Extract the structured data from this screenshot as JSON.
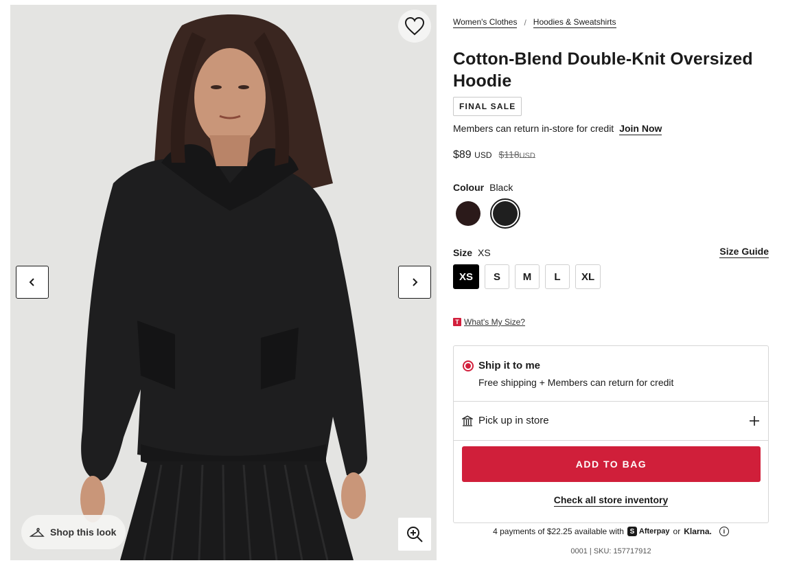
{
  "breadcrumb": [
    {
      "label": "Women's Clothes"
    },
    {
      "label": "Hoodies & Sweatshirts"
    }
  ],
  "breadcrumb_separator": "/",
  "product": {
    "title": "Cotton-Blend Double-Knit Oversized Hoodie",
    "badge": "FINAL SALE",
    "members_text": "Members can return in-store for credit",
    "join_link": "Join Now",
    "price_now": "$89",
    "price_now_currency": "USD",
    "price_was": "$118",
    "price_was_currency": "USD"
  },
  "colour": {
    "label": "Colour",
    "selected": "Black",
    "swatches": [
      {
        "name": "Espresso",
        "hex": "#2b1a1a",
        "selected": false
      },
      {
        "name": "Black",
        "hex": "#1f1f1f",
        "selected": true
      }
    ]
  },
  "size": {
    "label": "Size",
    "selected": "XS",
    "guide_label": "Size Guide",
    "options": [
      "XS",
      "S",
      "M",
      "L",
      "XL"
    ],
    "whats_my_size": "What's My Size?",
    "badge_letter": "T"
  },
  "fulfilment": {
    "ship_title": "Ship it to me",
    "ship_subtitle": "Free shipping + Members can return for credit",
    "pickup_label": "Pick up in store",
    "add_to_bag": "ADD TO BAG",
    "check_inventory": "Check all store inventory"
  },
  "payments": {
    "text": "4 payments of $22.25 available with",
    "afterpay": "Afterpay",
    "afterpay_mark": "S",
    "or": "or",
    "klarna": "Klarna."
  },
  "sku_line": "0001 | SKU: 157717912",
  "gallery": {
    "shop_look": "Shop this look"
  },
  "colors": {
    "accent": "#d01f3a",
    "image_bg": "#e4e4e2"
  }
}
